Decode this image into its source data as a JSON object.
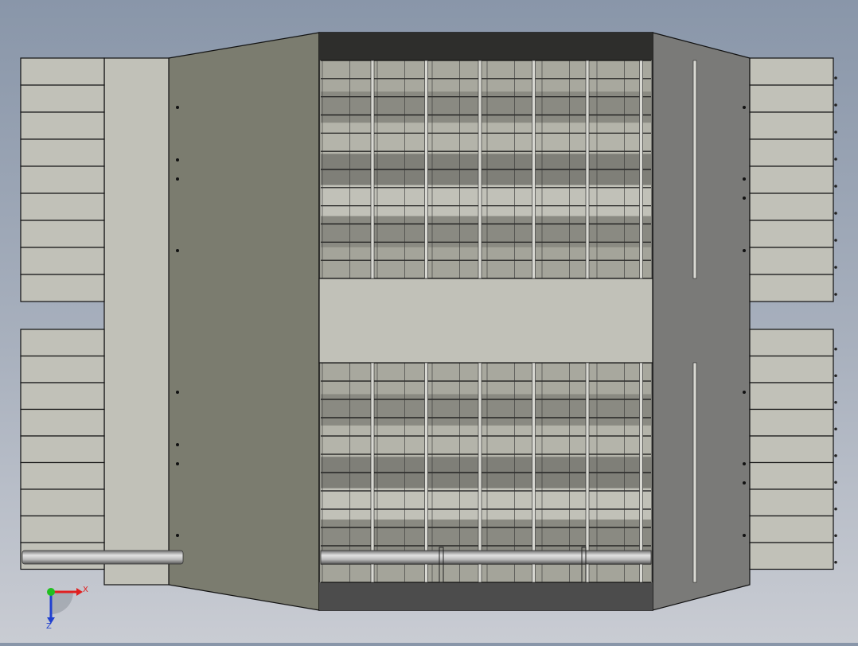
{
  "viewport": {
    "background_top": "#8996a9",
    "background_bottom": "#c9ccd3"
  },
  "model": {
    "plate_light": "#c1c1b8",
    "plate_dark_left": "#7b7c6f",
    "plate_dark_right": "#7a7a78",
    "band_dark": "#2e2e2c",
    "band_mid": "#4c4c4c",
    "edge": "#111111",
    "left_fin_rows": 9,
    "right_fin_rows": 9,
    "vertical_rods": 7
  },
  "triad": {
    "x_label": "X",
    "z_label": "Z",
    "x_color": "#e02020",
    "y_color": "#20c020",
    "z_color": "#2040d0"
  }
}
